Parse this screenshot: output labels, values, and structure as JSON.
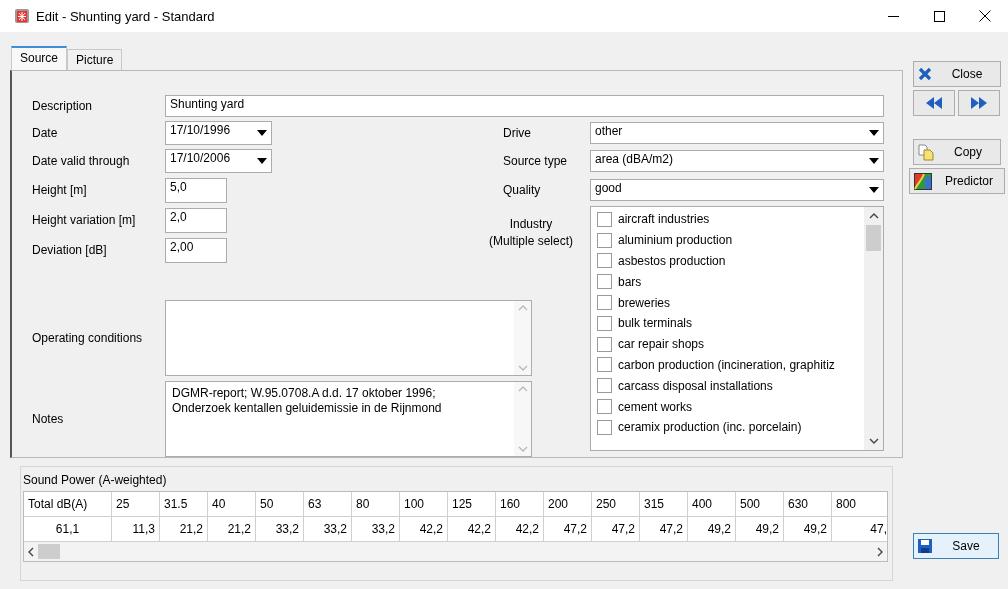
{
  "window": {
    "title": "Edit - Shunting yard - Standard"
  },
  "tabs": [
    {
      "label": "Source",
      "selected": true
    },
    {
      "label": "Picture",
      "selected": false
    }
  ],
  "description": {
    "label": "Description",
    "value": "Shunting yard"
  },
  "left_fields": [
    {
      "label": "Date",
      "value": "17/10/1996",
      "kind": "date"
    },
    {
      "label": "Date valid through",
      "value": "17/10/2006",
      "kind": "date"
    },
    {
      "label": "Height [m]",
      "value": "5,0",
      "kind": "number"
    },
    {
      "label": "Height variation [m]",
      "value": "2,0",
      "kind": "number"
    },
    {
      "label": "Deviation [dB]",
      "value": "2,00",
      "kind": "number"
    }
  ],
  "right_fields": [
    {
      "label": "Drive",
      "value": "other"
    },
    {
      "label": "Source type",
      "value": "area (dBA/m2)"
    },
    {
      "label": "Quality",
      "value": "good"
    }
  ],
  "industry": {
    "label": [
      "Industry",
      "(Multiple select)"
    ],
    "items": [
      {
        "label": "aircraft industries",
        "checked": false
      },
      {
        "label": "aluminium production",
        "checked": false
      },
      {
        "label": "asbestos production",
        "checked": false
      },
      {
        "label": "bars",
        "checked": false
      },
      {
        "label": "breweries",
        "checked": false
      },
      {
        "label": "bulk terminals",
        "checked": false
      },
      {
        "label": "car repair shops",
        "checked": false
      },
      {
        "label": "carbon production (incineration, graphitiz",
        "checked": false
      },
      {
        "label": "carcass disposal installations",
        "checked": false
      },
      {
        "label": "cement works",
        "checked": false
      },
      {
        "label": "ceramix production (inc. porcelain)",
        "checked": false
      }
    ]
  },
  "operating_conditions": {
    "label": "Operating conditions"
  },
  "notes": {
    "label": "Notes",
    "lines": [
      "DGMR-report; W.95.0708.A d.d. 17 oktober 1996;",
      "Onderzoek kentallen geluidemissie in de Rijnmond"
    ]
  },
  "side_buttons": [
    {
      "kind": "close",
      "label": "Close"
    },
    {
      "kind": "nav"
    },
    {
      "kind": "copy",
      "label": "Copy"
    },
    {
      "kind": "predictor",
      "label": "Predictor"
    }
  ],
  "save_button": {
    "label": "Save"
  },
  "sound_power": {
    "title": "Sound Power (A-weighted)",
    "columns": [
      "Total dB(A)",
      "25",
      "31.5",
      "40",
      "50",
      "63",
      "80",
      "100",
      "125",
      "160",
      "200",
      "250",
      "315",
      "400",
      "500",
      "630",
      "800"
    ],
    "rows": [
      [
        "61,1",
        "11,3",
        "21,2",
        "21,2",
        "33,2",
        "33,2",
        "33,2",
        "42,2",
        "42,2",
        "42,2",
        "47,2",
        "47,2",
        "47,2",
        "49,2",
        "49,2",
        "49,2",
        "47,"
      ]
    ]
  }
}
